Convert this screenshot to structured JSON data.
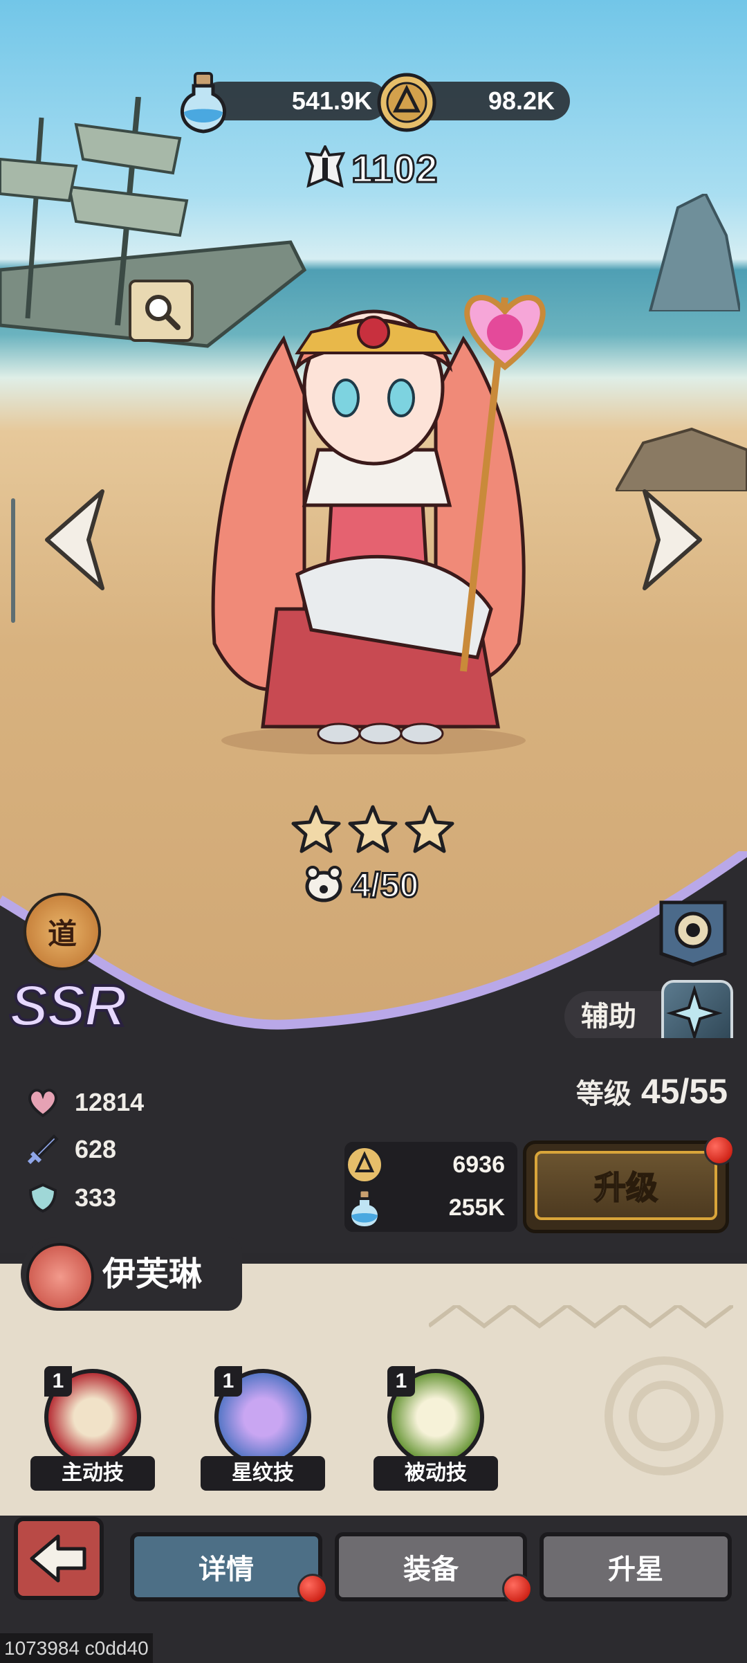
{
  "resources": {
    "potion_value": "541.9K",
    "coin_value": "98.2K"
  },
  "power": {
    "value": "1102"
  },
  "hero": {
    "stars": 3,
    "shards": "4/50",
    "badge_char": "道",
    "rarity": "SSR",
    "role": "辅助",
    "name": "伊芙琳"
  },
  "stats": {
    "hp": "12814",
    "attack": "628",
    "defense": "333"
  },
  "level": {
    "label": "等级",
    "value": "45/55"
  },
  "upgrade": {
    "coin_cost": "6936",
    "potion_cost": "255K",
    "button_label": "升级"
  },
  "skills": [
    {
      "label": "主动技",
      "level": "1"
    },
    {
      "label": "星纹技",
      "level": "1"
    },
    {
      "label": "被动技",
      "level": "1"
    }
  ],
  "tabs": [
    {
      "label": "详情"
    },
    {
      "label": "装备"
    },
    {
      "label": "升星"
    }
  ],
  "footer": {
    "id_text": "1073984 c0dd40"
  },
  "colors": {
    "panel_dark": "#2c2b2f",
    "panel_light": "#e5dccb",
    "accent_gold": "#d9a53a",
    "tab_active": "#4d6f86",
    "notify_red": "#d1261a"
  }
}
